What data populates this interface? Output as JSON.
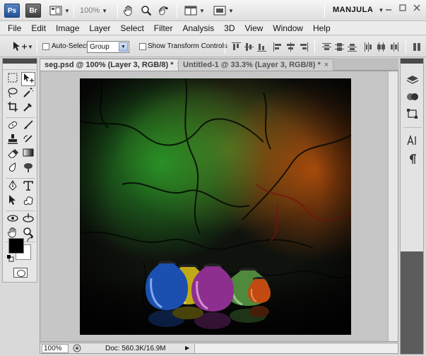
{
  "appbar": {
    "ps_logo": "Ps",
    "br_logo": "Br",
    "zoom": "100%",
    "workspace": "MANJULA",
    "icons": [
      "view-extras-icon",
      "hand-tool-icon",
      "zoom-tool-icon",
      "rotate-view-icon",
      "arrange-documents-icon",
      "screen-mode-icon"
    ]
  },
  "menu": [
    "File",
    "Edit",
    "Image",
    "Layer",
    "Select",
    "Filter",
    "Analysis",
    "3D",
    "View",
    "Window",
    "Help"
  ],
  "options": {
    "auto_select_label": "Auto-Select:",
    "auto_select_value": "Group",
    "transform_label": "Show Transform Controls"
  },
  "tabs": [
    {
      "label": "seg.psd @ 100% (Layer 3, RGB/8) *",
      "close": "×"
    },
    {
      "label": "Untitled-1 @ 33.3% (Layer 3, RGB/8) *",
      "close": "×"
    }
  ],
  "status": {
    "zoom": "100%",
    "doc_info": "Doc: 560.3K/16.9M"
  },
  "colors": {
    "foreground": "#000000",
    "background": "#ffffff"
  },
  "canvas_content": {
    "vase_colors": [
      "#1b4fb0",
      "#c9b417",
      "#8c2f8e",
      "#4f8a3c",
      "#c24a10"
    ]
  }
}
